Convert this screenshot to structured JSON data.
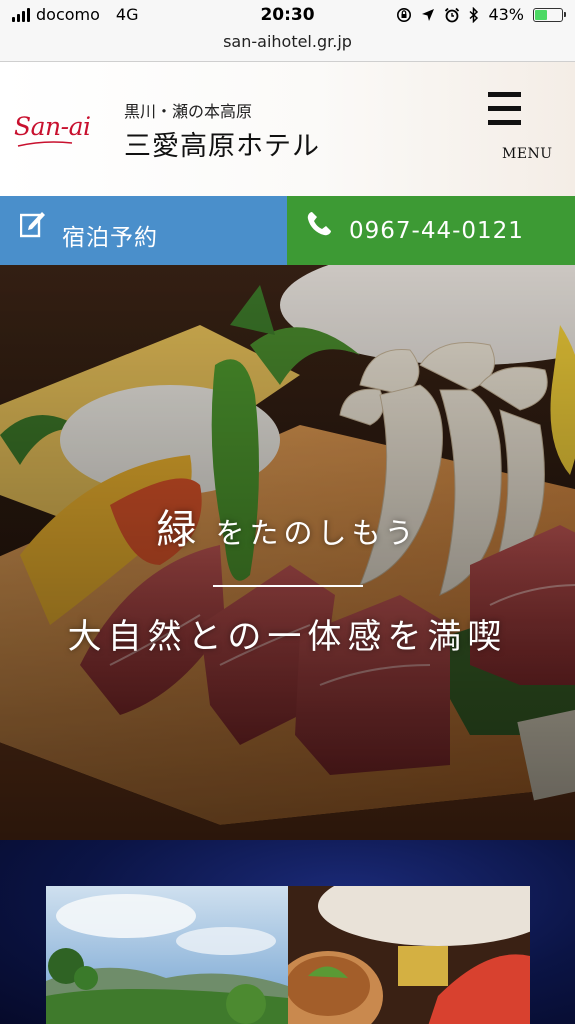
{
  "status_bar": {
    "carrier": "docomo",
    "network": "4G",
    "time": "20:30",
    "battery": "43%",
    "battery_level": 0.43,
    "icons": [
      "rotation-lock-icon",
      "location-icon",
      "alarm-icon",
      "bluetooth-icon"
    ]
  },
  "browser": {
    "url": "san-aihotel.gr.jp"
  },
  "header": {
    "logo_text": "San-ai",
    "subtitle": "黒川・瀬の本高原",
    "hotel_name": "三愛高原ホテル",
    "menu_label": "MENU"
  },
  "actions": {
    "booking_label": "宿泊予約",
    "booking_color": "#4a8fcb",
    "phone_label": "0967-44-0121",
    "phone_color": "#3d9a34"
  },
  "hero": {
    "line1_big": "緑",
    "line1_rest": "をたのしもう",
    "line2": "大自然との一体感を満喫"
  },
  "colors": {
    "brand_red": "#c8102e",
    "night_blue": "#0b1445"
  }
}
